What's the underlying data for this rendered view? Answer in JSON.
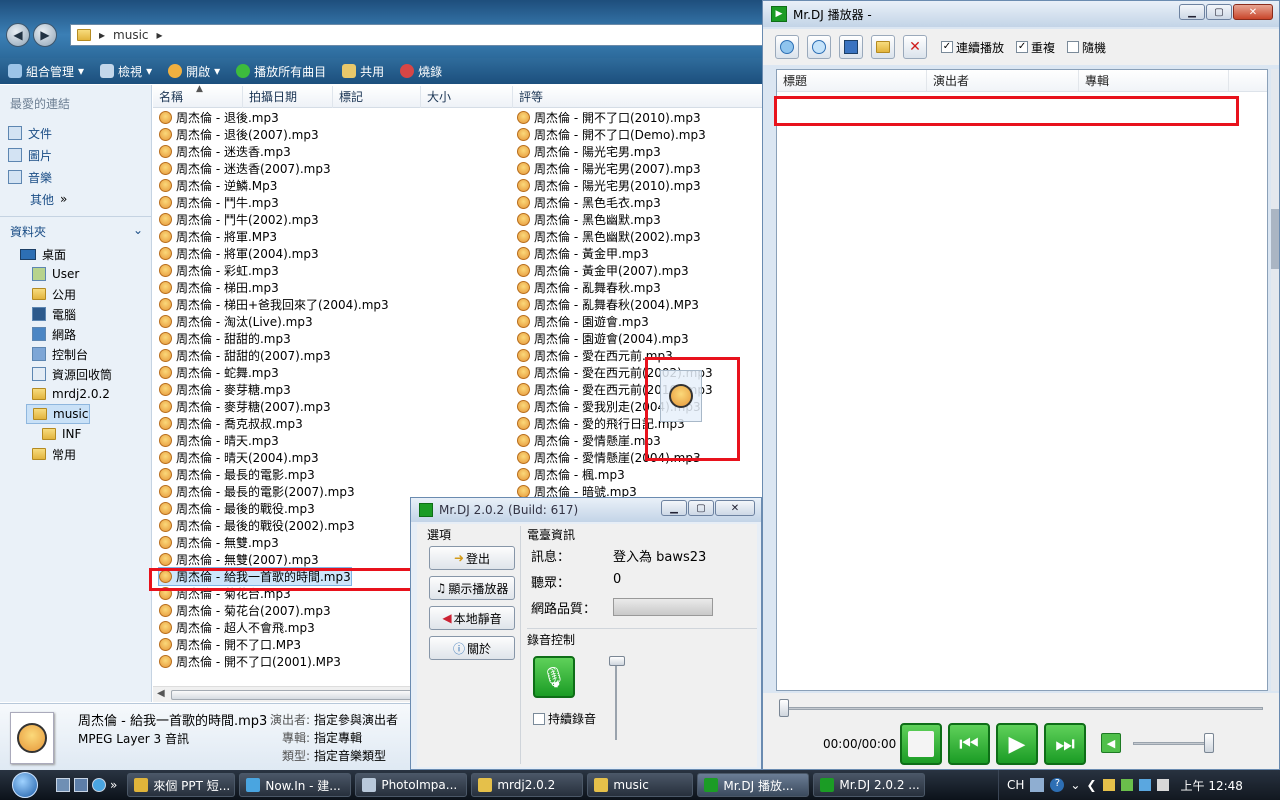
{
  "explorer": {
    "address": "music",
    "toolbar": [
      "組合管理",
      "檢視",
      "開啟",
      "播放所有曲目",
      "共用",
      "燒錄"
    ],
    "left": {
      "fav_header": "最愛的連結",
      "favorites": [
        "文件",
        "圖片",
        "音樂"
      ],
      "more": "其他",
      "more_arrows": "»",
      "folders_header": "資料夾",
      "tree": [
        "桌面",
        "User",
        "公用",
        "電腦",
        "網路",
        "控制台",
        "資源回收筒",
        "mrdj2.0.2",
        "music",
        "INF",
        "常用"
      ]
    },
    "columns": [
      "名稱",
      "拍攝日期",
      "標記",
      "大小",
      "評等"
    ],
    "files_col1": [
      "周杰倫 - 退後.mp3",
      "周杰倫 - 退後(2007).mp3",
      "周杰倫 - 迷迭香.mp3",
      "周杰倫 - 迷迭香(2007).mp3",
      "周杰倫 - 逆鱗.Mp3",
      "周杰倫 - 鬥牛.mp3",
      "周杰倫 - 鬥牛(2002).mp3",
      "周杰倫 - 將軍.MP3",
      "周杰倫 - 將軍(2004).mp3",
      "周杰倫 - 彩虹.mp3",
      "周杰倫 - 梯田.mp3",
      "周杰倫 - 梯田+爸我回來了(2004).mp3",
      "周杰倫 - 淘汰(Live).mp3",
      "周杰倫 - 甜甜的.mp3",
      "周杰倫 - 甜甜的(2007).mp3",
      "周杰倫 - 蛇舞.mp3",
      "周杰倫 - 麥芽糖.mp3",
      "周杰倫 - 麥芽糖(2007).mp3",
      "周杰倫 - 喬克叔叔.mp3",
      "周杰倫 - 晴天.mp3",
      "周杰倫 - 晴天(2004).mp3",
      "周杰倫 - 最長的電影.mp3",
      "周杰倫 - 最長的電影(2007).mp3",
      "周杰倫 - 最後的戰役.mp3",
      "周杰倫 - 最後的戰役(2002).mp3",
      "周杰倫 - 無雙.mp3",
      "周杰倫 - 無雙(2007).mp3",
      "周杰倫 - 給我一首歌的時間.mp3",
      "周杰倫 - 菊花台.mp3",
      "周杰倫 - 菊花台(2007).mp3",
      "周杰倫 - 超人不會飛.mp3",
      "周杰倫 - 開不了口.MP3",
      "周杰倫 - 開不了口(2001).MP3"
    ],
    "files_col2": [
      "周杰倫 - 開不了口(2010).mp3",
      "周杰倫 - 開不了口(Demo).mp3",
      "周杰倫 - 陽光宅男.mp3",
      "周杰倫 - 陽光宅男(2007).mp3",
      "周杰倫 - 陽光宅男(2010).mp3",
      "周杰倫 - 黑色毛衣.mp3",
      "周杰倫 - 黑色幽默.mp3",
      "周杰倫 - 黑色幽默(2002).mp3",
      "周杰倫 - 黃金甲.mp3",
      "周杰倫 - 黃金甲(2007).mp3",
      "周杰倫 - 亂舞春秋.mp3",
      "周杰倫 - 亂舞春秋(2004).MP3",
      "周杰倫 - 園遊會.mp3",
      "周杰倫 - 園遊會(2004).mp3",
      "周杰倫 - 愛在西元前.mp3",
      "周杰倫 - 愛在西元前(2002).mp3",
      "周杰倫 - 愛在西元前(2010).mp3",
      "周杰倫 - 愛我別走(2004).mp3",
      "周杰倫 - 愛的飛行日記.mp3",
      "周杰倫 - 愛情懸崖.mp3",
      "周杰倫 - 愛情懸崖(2004).mp3",
      "周杰倫 - 楓.mp3",
      "周杰倫 - 暗號.mp3"
    ],
    "details": {
      "filename": "周杰倫 - 給我一首歌的時間.mp3",
      "type": "MPEG Layer 3 音訊",
      "artist_label": "演出者:",
      "artist_value": "指定參與演出者",
      "album_label": "專輯:",
      "album_value": "指定專輯",
      "genre_label": "類型:",
      "genre_value": "指定音樂類型"
    }
  },
  "player": {
    "title": "Mr.DJ 播放器 -",
    "checks": [
      {
        "label": "連續播放",
        "checked": true
      },
      {
        "label": "重複",
        "checked": true
      },
      {
        "label": "隨機",
        "checked": false
      }
    ],
    "columns": [
      "標題",
      "演出者",
      "專輯"
    ],
    "time": "00:00/00:00"
  },
  "small": {
    "title": "Mr.DJ 2.0.2 (Build: 617)",
    "options_label": "選項",
    "buttons": [
      "登出",
      "顯示播放器",
      "本地靜音",
      "關於"
    ],
    "info_label": "電臺資訊",
    "message_label": "訊息：",
    "message_value": "登入為 baws23",
    "listeners_label": "聽眾：",
    "listeners_value": "0",
    "quality_label": "網路品質：",
    "record_label": "錄音控制",
    "continuous_record": "持續錄音"
  },
  "taskbar": {
    "items": [
      "來個 PPT 短...",
      "Now.In - 建...",
      "PhotoImpa...",
      "mrdj2.0.2",
      "music",
      "Mr.DJ 播放...",
      "Mr.DJ 2.0.2 ..."
    ],
    "more_arrows": "»",
    "lang": "CH",
    "clock": "上午 12:48"
  },
  "colors": {
    "accent": "#e8121c",
    "play_green": "#1b9c25"
  }
}
